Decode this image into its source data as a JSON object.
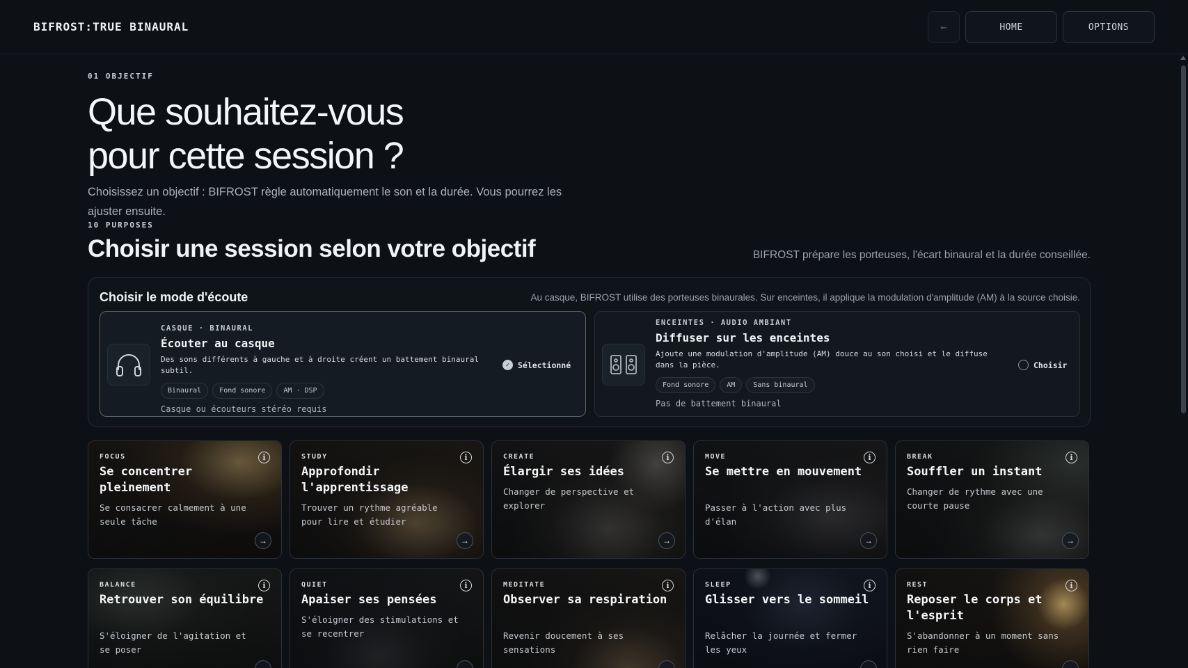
{
  "app": {
    "title": "BIFROST:TRUE BINAURAL"
  },
  "nav": {
    "back_label": "←",
    "home_label": "HOME",
    "options_label": "OPTIONS"
  },
  "intro": {
    "eyebrow": "01 OBJECTIF",
    "title_line1": "Que souhaitez-vous",
    "title_line2": "pour cette session ?",
    "subtitle": "Choisissez un objectif : BIFROST règle automatiquement le son et la durée. Vous pourrez les ajuster ensuite."
  },
  "section": {
    "eyebrow": "10 PURPOSES",
    "title": "Choisir une session selon votre objectif",
    "note": "BIFROST prépare les porteuses, l'écart binaural et la durée conseillée."
  },
  "mode": {
    "heading": "Choisir le mode d'écoute",
    "note": "Au casque, BIFROST utilise des porteuses binaurales. Sur enceintes, il applique la modulation d'amplitude (AM) à la source choisie.",
    "options": [
      {
        "kicker": "CASQUE · BINAURAL",
        "title": "Écouter au casque",
        "desc": "Des sons différents à gauche et à droite créent un battement binaural subtil.",
        "chips": [
          "Binaural",
          "Fond sonore",
          "AM · DSP"
        ],
        "requirement": "Casque ou écouteurs stéréo requis",
        "status": "Sélectionné",
        "icon": "headphones-icon"
      },
      {
        "kicker": "ENCEINTES · AUDIO AMBIANT",
        "title": "Diffuser sur les enceintes",
        "desc": "Ajoute une modulation d'amplitude (AM) douce au son choisi et le diffuse dans la pièce.",
        "chips": [
          "Fond sonore",
          "AM",
          "Sans binaural"
        ],
        "requirement": "Pas de battement binaural",
        "status": "Choisir",
        "icon": "speakers-icon"
      }
    ]
  },
  "purposes": [
    {
      "kicker": "FOCUS",
      "title": "Se concentrer pleinement",
      "desc": "Se consacrer calmement à une seule tâche"
    },
    {
      "kicker": "STUDY",
      "title": "Approfondir l'apprentissage",
      "desc": "Trouver un rythme agréable pour lire et étudier"
    },
    {
      "kicker": "CREATE",
      "title": "Élargir ses idées",
      "desc": "Changer de perspective et explorer"
    },
    {
      "kicker": "MOVE",
      "title": "Se mettre en mouvement",
      "desc": "Passer à l'action avec plus d'élan"
    },
    {
      "kicker": "BREAK",
      "title": "Souffler un instant",
      "desc": "Changer de rythme avec une courte pause"
    },
    {
      "kicker": "BALANCE",
      "title": "Retrouver son équilibre",
      "desc": "S'éloigner de l'agitation et se poser"
    },
    {
      "kicker": "QUIET",
      "title": "Apaiser ses pensées",
      "desc": "S'éloigner des stimulations et se recentrer"
    },
    {
      "kicker": "MEDITATE",
      "title": "Observer sa respiration",
      "desc": "Revenir doucement à ses sensations"
    },
    {
      "kicker": "SLEEP",
      "title": "Glisser vers le sommeil",
      "desc": "Relâcher la journée et fermer les yeux"
    },
    {
      "kicker": "REST",
      "title": "Reposer le corps et l'esprit",
      "desc": "S'abandonner à un moment sans rien faire"
    }
  ],
  "icons": {
    "info": "info-icon",
    "arrow": "arrow-right-icon"
  },
  "colors": {
    "background": "#0d1116",
    "accent": "#f1f3f6"
  }
}
